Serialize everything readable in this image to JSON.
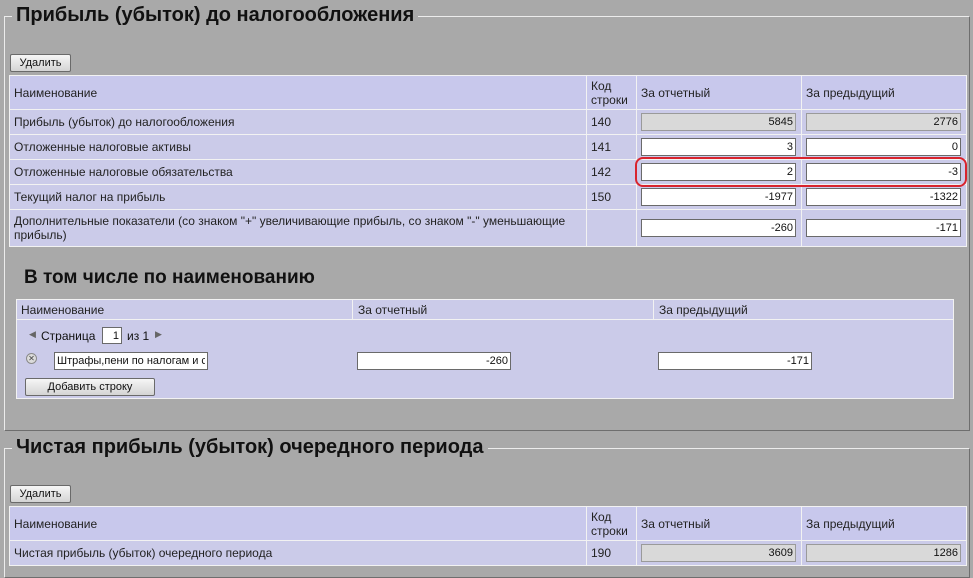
{
  "section1": {
    "title": "Прибыль (убыток) до налогообложения",
    "delete_label": "Удалить",
    "columns": {
      "name": "Наименование",
      "code": "Код строки",
      "current": "За отчетный",
      "previous": "За предыдущий"
    },
    "rows": [
      {
        "name": "Прибыль (убыток) до налогообложения",
        "code": "140",
        "current": "5845",
        "previous": "2776",
        "readonly": true
      },
      {
        "name": "Отложенные налоговые активы",
        "code": "141",
        "current": "3",
        "previous": "0",
        "readonly": false
      },
      {
        "name": "Отложенные налоговые обязательства",
        "code": "142",
        "current": "2",
        "previous": "-3",
        "readonly": false
      },
      {
        "name": "Текущий налог на прибыль",
        "code": "150",
        "current": "-1977",
        "previous": "-1322",
        "readonly": false
      },
      {
        "name": "Дополнительные показатели (со знаком \"+\" увеличивающие прибыль, со знаком \"-\" уменьшающие прибыль)",
        "code": "",
        "current": "-260",
        "previous": "-171",
        "readonly": false
      }
    ]
  },
  "subsection": {
    "title": "В том числе по наименованию",
    "columns": {
      "name": "Наименование",
      "current": "За отчетный",
      "previous": "За предыдущий"
    },
    "pager": {
      "page_label": "Страница",
      "page": "1",
      "of_label": "из 1"
    },
    "rows": [
      {
        "name": "Штрафы,пени по налогам и сб",
        "current": "-260",
        "previous": "-171"
      }
    ],
    "add_row_label": "Добавить строку"
  },
  "section2": {
    "title": "Чистая прибыль (убыток) очередного периода",
    "delete_label": "Удалить",
    "columns": {
      "name": "Наименование",
      "code": "Код строки",
      "current": "За отчетный",
      "previous": "За предыдущий"
    },
    "rows": [
      {
        "name": "Чистая прибыль (убыток) очередного периода",
        "code": "190",
        "current": "3609",
        "previous": "1286",
        "readonly": true
      }
    ]
  },
  "colors": {
    "grid": "#cbcbe9",
    "background": "#a9a9a9",
    "highlight": "#d8242e"
  },
  "icons": {
    "delete_row": "close-circle-icon",
    "prev_page": "triangle-left-icon",
    "next_page": "triangle-right-icon"
  }
}
